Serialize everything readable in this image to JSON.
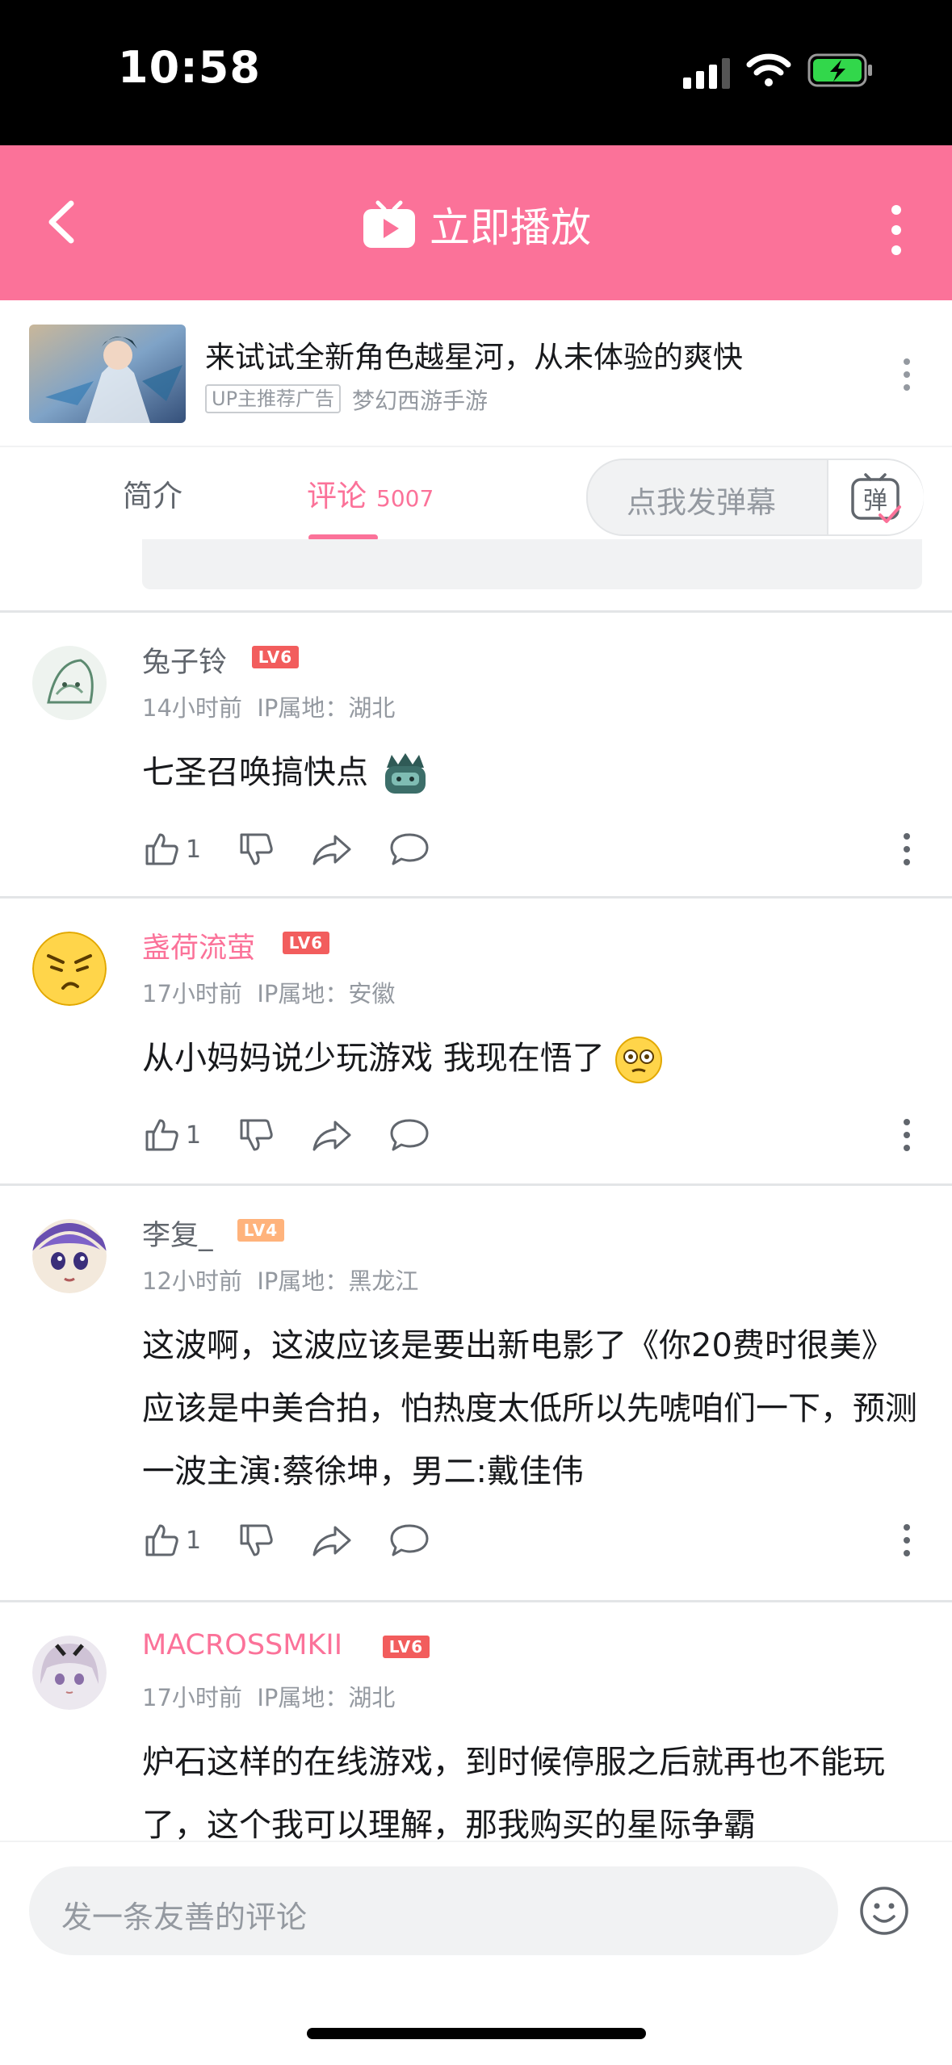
{
  "status_bar": {
    "time": "10:58"
  },
  "nav": {
    "title": "立即播放"
  },
  "ad": {
    "title": "来试试全新角色越星河，从未体验的爽快",
    "tag": "UP主推荐广告",
    "source": "梦幻西游手游"
  },
  "tabs": {
    "intro": "简介",
    "comments": "评论",
    "comments_count": "5007",
    "danmu_placeholder": "点我发弹幕",
    "danmu_button": "弹"
  },
  "comments": [
    {
      "user": "兔子铃",
      "level": "LV6",
      "time": "14小时前",
      "ip": "IP属地：湖北",
      "text": "七圣召唤搞快点",
      "likes": "1"
    },
    {
      "user": "盏荷流萤",
      "level": "LV6",
      "time": "17小时前",
      "ip": "IP属地：安徽",
      "text": "从小妈妈说少玩游戏 我现在悟了",
      "likes": "1"
    },
    {
      "user": "李复_",
      "level": "LV4",
      "time": "12小时前",
      "ip": "IP属地：黑龙江",
      "text": "这波啊，这波应该是要出新电影了《你20费时很美》应该是中美合拍，怕热度太低所以先唬咱们一下，预测一波主演:蔡徐坤，男二:戴佳伟",
      "likes": "1"
    },
    {
      "user": "MACROSSMKII",
      "level": "LV6",
      "time": "17小时前",
      "ip": "IP属地：湖北",
      "text": "炉石这样的在线游戏，到时候停服之后就再也不能玩了，这个我可以理解，那我购买的星际争霸"
    }
  ],
  "input": {
    "placeholder": "发一条友善的评论"
  },
  "colors": {
    "brand_pink": "#fb7299",
    "lv6": "#f25d5d",
    "lv4": "#ffb37c"
  }
}
